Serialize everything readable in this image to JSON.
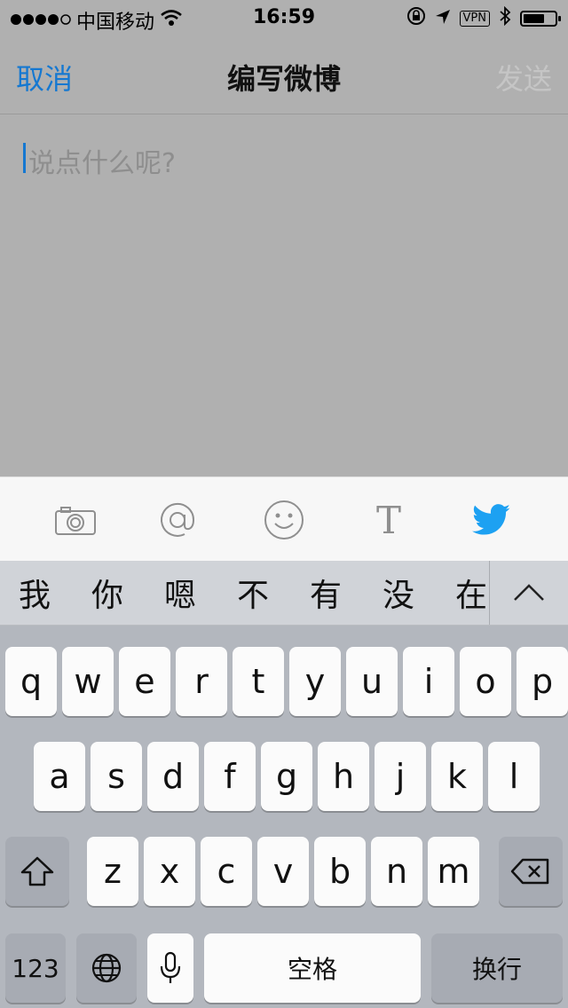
{
  "status_bar": {
    "carrier": "中国移动",
    "time": "16:59",
    "vpn": "VPN"
  },
  "navbar": {
    "cancel": "取消",
    "title": "编写微博",
    "send": "发送"
  },
  "compose": {
    "placeholder": "说点什么呢?"
  },
  "toolbar": {
    "text_tool": "T"
  },
  "candidates": [
    "我",
    "你",
    "嗯",
    "不",
    "有",
    "没",
    "在"
  ],
  "keyboard": {
    "row1": [
      "q",
      "w",
      "e",
      "r",
      "t",
      "y",
      "u",
      "i",
      "o",
      "p"
    ],
    "row2": [
      "a",
      "s",
      "d",
      "f",
      "g",
      "h",
      "j",
      "k",
      "l"
    ],
    "row3": [
      "z",
      "x",
      "c",
      "v",
      "b",
      "n",
      "m"
    ],
    "numbers": "123",
    "space": "空格",
    "return": "换行"
  },
  "colors": {
    "accent": "#1578d1",
    "twitter": "#1da1f2",
    "disabled": "#c5c5c5"
  }
}
